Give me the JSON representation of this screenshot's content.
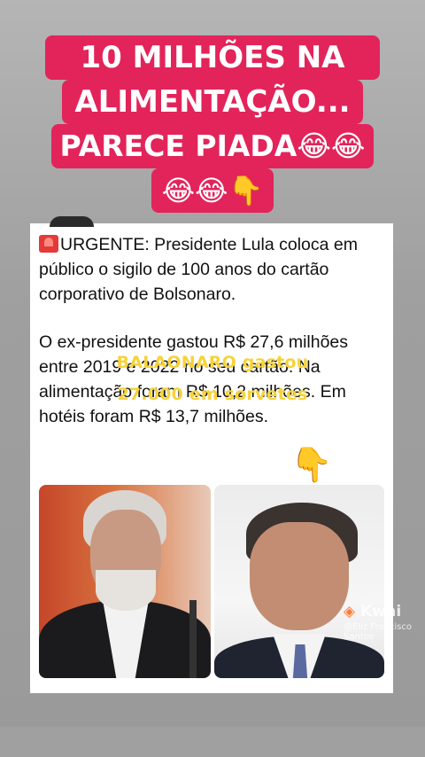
{
  "headline": {
    "line1": "10 MILHÕES NA",
    "line2": "ALIMENTAÇÃO...",
    "line3": "PARECE PIADA😂😂",
    "line4": "😂😂👇"
  },
  "tweet": {
    "part1_bold": "URGENTE:",
    "part1_rest": " Presidente Lula coloca em público o sigilo de 100 anos do cartão corporativo de Bolsonaro.",
    "part2": "O ex-presidente gastou R$ 27,6 milhões entre 2019 e 2022 no seu cartão. Na alimentação foram R$ 10,2 milhões. Em hotéis foram R$ 13,7 milhões."
  },
  "overlay": {
    "line1": "BALAONARO gastou",
    "line2": "27.000 em sorvetes"
  },
  "pointer_emoji": "👇",
  "watermark": {
    "app": "Kwai",
    "user": "@Eliz Francisco Santos"
  },
  "icons": {
    "siren": "siren-icon",
    "pointer": "pointing-down-hand-icon",
    "kwai": "kwai-logo-icon"
  },
  "colors": {
    "headline_bg": "#e2245a",
    "overlay_text": "#f6d33a",
    "card_bg": "#ffffff"
  }
}
